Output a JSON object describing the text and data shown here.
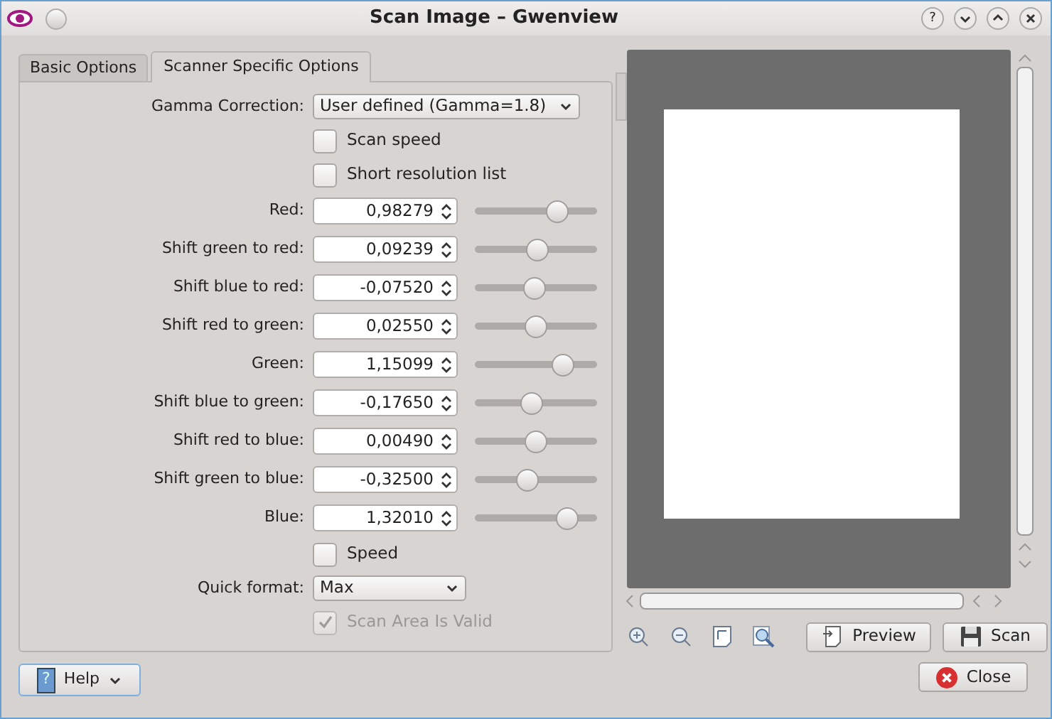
{
  "window": {
    "title": "Scan Image – Gwenview",
    "help_glyph": "?"
  },
  "tabs": [
    {
      "label": "Basic Options",
      "selected": false
    },
    {
      "label": "Scanner Specific Options",
      "selected": true
    }
  ],
  "options": [
    {
      "kind": "combo",
      "label": "Gamma Correction:",
      "value": "User defined (Gamma=1.8)"
    },
    {
      "kind": "checkbox",
      "label": "Scan speed",
      "checked": false,
      "disabled": false
    },
    {
      "kind": "checkbox",
      "label": "Short resolution list",
      "checked": false,
      "disabled": false
    },
    {
      "kind": "spin",
      "label": "Red:",
      "value": "0,98279",
      "level": 0.72
    },
    {
      "kind": "spin",
      "label": "Shift green to red:",
      "value": "0,09239",
      "level": 0.52
    },
    {
      "kind": "spin",
      "label": "Shift blue to red:",
      "value": "-0,07520",
      "level": 0.48
    },
    {
      "kind": "spin",
      "label": "Shift red to green:",
      "value": "0,02550",
      "level": 0.5
    },
    {
      "kind": "spin",
      "label": "Green:",
      "value": "1,15099",
      "level": 0.77
    },
    {
      "kind": "spin",
      "label": "Shift blue to green:",
      "value": "-0,17650",
      "level": 0.46
    },
    {
      "kind": "spin",
      "label": "Shift red to blue:",
      "value": "0,00490",
      "level": 0.5
    },
    {
      "kind": "spin",
      "label": "Shift green to blue:",
      "value": "-0,32500",
      "level": 0.42
    },
    {
      "kind": "spin",
      "label": "Blue:",
      "value": "1,32010",
      "level": 0.81
    },
    {
      "kind": "checkbox",
      "label": "Speed",
      "checked": false,
      "disabled": false
    },
    {
      "kind": "combo",
      "label": "Quick format:",
      "value": "Max",
      "short": true
    },
    {
      "kind": "checkbox",
      "label": "Scan Area Is Valid",
      "checked": true,
      "disabled": true
    }
  ],
  "buttons": {
    "help_glyph": "?",
    "help": "Help",
    "preview": "Preview",
    "scan": "Scan",
    "close": "Close"
  }
}
